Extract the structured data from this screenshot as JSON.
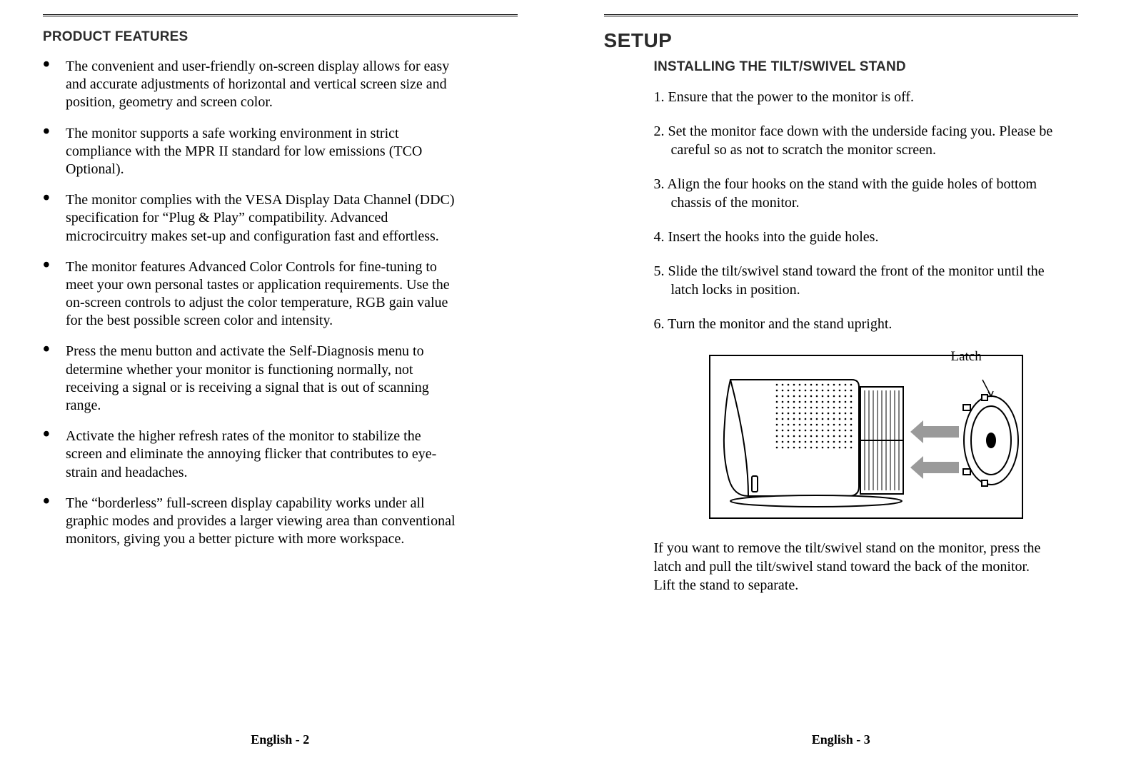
{
  "left": {
    "heading": "PRODUCT FEATURES",
    "features": [
      "The convenient and user-friendly on-screen display allows for easy and accurate adjustments of horizontal and vertical screen size and position, geometry and screen color.",
      "The monitor supports a safe working environment in strict compliance with the MPR II standard for low emissions (TCO Optional).",
      "The monitor complies with the VESA Display Data Channel (DDC) specification for “Plug & Play” compatibility. Advanced microcircuitry makes set-up and configuration fast and effortless.",
      "The monitor features Advanced Color Controls for fine-tuning to meet your own personal tastes or application requirements.  Use the on-screen controls to adjust the color temperature, RGB gain value for the best possible screen color and intensity.",
      "Press the menu button and activate the Self-Diagnosis menu to determine whether your monitor is functioning normally, not receiving a signal or is receiving a signal that is out of scanning range.",
      "Activate the higher refresh rates of the monitor to stabilize the screen and eliminate the annoying flicker that contributes to eye-strain and headaches.",
      "The “borderless” full-screen display capability works under all graphic modes and provides a larger viewing area than conventional monitors, giving you a better picture with more workspace."
    ],
    "footer": "English - 2"
  },
  "right": {
    "title": "SETUP",
    "heading": "INSTALLING THE TILT/SWIVEL STAND",
    "steps": [
      "1. Ensure that the power to the monitor is off.",
      "2. Set the monitor face down with the underside facing you. Please be careful so as not to scratch the monitor screen.",
      "3. Align the four hooks on the stand with the guide holes of bottom chassis of the monitor.",
      "4. Insert the hooks into the guide holes.",
      "5. Slide the tilt/swivel stand toward the front of the monitor until the latch locks in position.",
      "6. Turn the monitor and the stand upright."
    ],
    "figure_label": "Latch",
    "note": "If you want to remove the tilt/swivel stand on the monitor, press the latch and pull the tilt/swivel stand toward the back of the monitor.  Lift the stand to separate.",
    "footer": "English - 3"
  }
}
